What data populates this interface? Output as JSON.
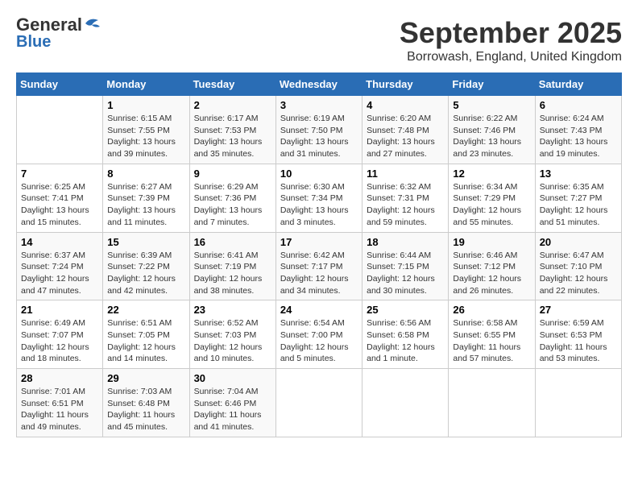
{
  "logo": {
    "general": "General",
    "blue": "Blue"
  },
  "title": "September 2025",
  "location": "Borrowash, England, United Kingdom",
  "days_of_week": [
    "Sunday",
    "Monday",
    "Tuesday",
    "Wednesday",
    "Thursday",
    "Friday",
    "Saturday"
  ],
  "weeks": [
    [
      {
        "day": "",
        "sunrise": "",
        "sunset": "",
        "daylight": ""
      },
      {
        "day": "1",
        "sunrise": "Sunrise: 6:15 AM",
        "sunset": "Sunset: 7:55 PM",
        "daylight": "Daylight: 13 hours and 39 minutes."
      },
      {
        "day": "2",
        "sunrise": "Sunrise: 6:17 AM",
        "sunset": "Sunset: 7:53 PM",
        "daylight": "Daylight: 13 hours and 35 minutes."
      },
      {
        "day": "3",
        "sunrise": "Sunrise: 6:19 AM",
        "sunset": "Sunset: 7:50 PM",
        "daylight": "Daylight: 13 hours and 31 minutes."
      },
      {
        "day": "4",
        "sunrise": "Sunrise: 6:20 AM",
        "sunset": "Sunset: 7:48 PM",
        "daylight": "Daylight: 13 hours and 27 minutes."
      },
      {
        "day": "5",
        "sunrise": "Sunrise: 6:22 AM",
        "sunset": "Sunset: 7:46 PM",
        "daylight": "Daylight: 13 hours and 23 minutes."
      },
      {
        "day": "6",
        "sunrise": "Sunrise: 6:24 AM",
        "sunset": "Sunset: 7:43 PM",
        "daylight": "Daylight: 13 hours and 19 minutes."
      }
    ],
    [
      {
        "day": "7",
        "sunrise": "Sunrise: 6:25 AM",
        "sunset": "Sunset: 7:41 PM",
        "daylight": "Daylight: 13 hours and 15 minutes."
      },
      {
        "day": "8",
        "sunrise": "Sunrise: 6:27 AM",
        "sunset": "Sunset: 7:39 PM",
        "daylight": "Daylight: 13 hours and 11 minutes."
      },
      {
        "day": "9",
        "sunrise": "Sunrise: 6:29 AM",
        "sunset": "Sunset: 7:36 PM",
        "daylight": "Daylight: 13 hours and 7 minutes."
      },
      {
        "day": "10",
        "sunrise": "Sunrise: 6:30 AM",
        "sunset": "Sunset: 7:34 PM",
        "daylight": "Daylight: 13 hours and 3 minutes."
      },
      {
        "day": "11",
        "sunrise": "Sunrise: 6:32 AM",
        "sunset": "Sunset: 7:31 PM",
        "daylight": "Daylight: 12 hours and 59 minutes."
      },
      {
        "day": "12",
        "sunrise": "Sunrise: 6:34 AM",
        "sunset": "Sunset: 7:29 PM",
        "daylight": "Daylight: 12 hours and 55 minutes."
      },
      {
        "day": "13",
        "sunrise": "Sunrise: 6:35 AM",
        "sunset": "Sunset: 7:27 PM",
        "daylight": "Daylight: 12 hours and 51 minutes."
      }
    ],
    [
      {
        "day": "14",
        "sunrise": "Sunrise: 6:37 AM",
        "sunset": "Sunset: 7:24 PM",
        "daylight": "Daylight: 12 hours and 47 minutes."
      },
      {
        "day": "15",
        "sunrise": "Sunrise: 6:39 AM",
        "sunset": "Sunset: 7:22 PM",
        "daylight": "Daylight: 12 hours and 42 minutes."
      },
      {
        "day": "16",
        "sunrise": "Sunrise: 6:41 AM",
        "sunset": "Sunset: 7:19 PM",
        "daylight": "Daylight: 12 hours and 38 minutes."
      },
      {
        "day": "17",
        "sunrise": "Sunrise: 6:42 AM",
        "sunset": "Sunset: 7:17 PM",
        "daylight": "Daylight: 12 hours and 34 minutes."
      },
      {
        "day": "18",
        "sunrise": "Sunrise: 6:44 AM",
        "sunset": "Sunset: 7:15 PM",
        "daylight": "Daylight: 12 hours and 30 minutes."
      },
      {
        "day": "19",
        "sunrise": "Sunrise: 6:46 AM",
        "sunset": "Sunset: 7:12 PM",
        "daylight": "Daylight: 12 hours and 26 minutes."
      },
      {
        "day": "20",
        "sunrise": "Sunrise: 6:47 AM",
        "sunset": "Sunset: 7:10 PM",
        "daylight": "Daylight: 12 hours and 22 minutes."
      }
    ],
    [
      {
        "day": "21",
        "sunrise": "Sunrise: 6:49 AM",
        "sunset": "Sunset: 7:07 PM",
        "daylight": "Daylight: 12 hours and 18 minutes."
      },
      {
        "day": "22",
        "sunrise": "Sunrise: 6:51 AM",
        "sunset": "Sunset: 7:05 PM",
        "daylight": "Daylight: 12 hours and 14 minutes."
      },
      {
        "day": "23",
        "sunrise": "Sunrise: 6:52 AM",
        "sunset": "Sunset: 7:03 PM",
        "daylight": "Daylight: 12 hours and 10 minutes."
      },
      {
        "day": "24",
        "sunrise": "Sunrise: 6:54 AM",
        "sunset": "Sunset: 7:00 PM",
        "daylight": "Daylight: 12 hours and 5 minutes."
      },
      {
        "day": "25",
        "sunrise": "Sunrise: 6:56 AM",
        "sunset": "Sunset: 6:58 PM",
        "daylight": "Daylight: 12 hours and 1 minute."
      },
      {
        "day": "26",
        "sunrise": "Sunrise: 6:58 AM",
        "sunset": "Sunset: 6:55 PM",
        "daylight": "Daylight: 11 hours and 57 minutes."
      },
      {
        "day": "27",
        "sunrise": "Sunrise: 6:59 AM",
        "sunset": "Sunset: 6:53 PM",
        "daylight": "Daylight: 11 hours and 53 minutes."
      }
    ],
    [
      {
        "day": "28",
        "sunrise": "Sunrise: 7:01 AM",
        "sunset": "Sunset: 6:51 PM",
        "daylight": "Daylight: 11 hours and 49 minutes."
      },
      {
        "day": "29",
        "sunrise": "Sunrise: 7:03 AM",
        "sunset": "Sunset: 6:48 PM",
        "daylight": "Daylight: 11 hours and 45 minutes."
      },
      {
        "day": "30",
        "sunrise": "Sunrise: 7:04 AM",
        "sunset": "Sunset: 6:46 PM",
        "daylight": "Daylight: 11 hours and 41 minutes."
      },
      {
        "day": "",
        "sunrise": "",
        "sunset": "",
        "daylight": ""
      },
      {
        "day": "",
        "sunrise": "",
        "sunset": "",
        "daylight": ""
      },
      {
        "day": "",
        "sunrise": "",
        "sunset": "",
        "daylight": ""
      },
      {
        "day": "",
        "sunrise": "",
        "sunset": "",
        "daylight": ""
      }
    ]
  ]
}
